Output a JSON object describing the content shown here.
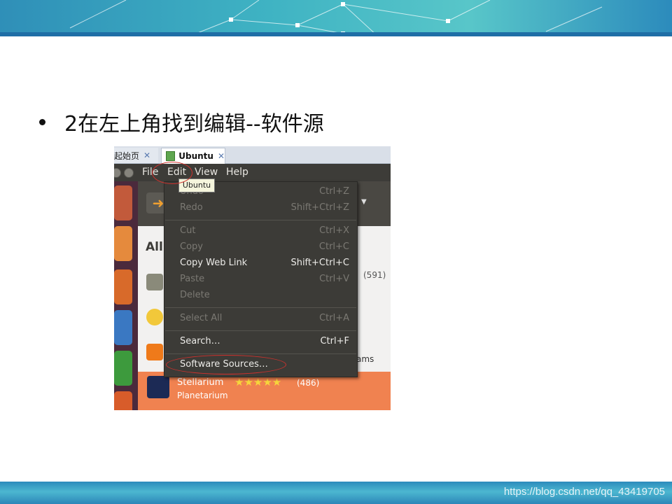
{
  "slide": {
    "instruction": "2在左上角找到编辑--软件源",
    "watermark": "https://blog.csdn.net/qq_43419705"
  },
  "browser_tabs": [
    {
      "label": "起始页",
      "close": "✕"
    },
    {
      "label": "Ubuntu",
      "close": "✕"
    }
  ],
  "menubar": {
    "file": "File",
    "edit": "Edit",
    "view": "View",
    "help": "Help"
  },
  "tooltip": "Ubuntu",
  "edit_menu": [
    {
      "label": "Undo",
      "shortcut": "Ctrl+Z",
      "enabled": false
    },
    {
      "label": "Redo",
      "shortcut": "Shift+Ctrl+Z",
      "enabled": false
    },
    {
      "label": "Cut",
      "shortcut": "Ctrl+X",
      "enabled": false
    },
    {
      "label": "Copy",
      "shortcut": "Ctrl+C",
      "enabled": false
    },
    {
      "label": "Copy Web Link",
      "shortcut": "Shift+Ctrl+C",
      "enabled": true
    },
    {
      "label": "Paste",
      "shortcut": "Ctrl+V",
      "enabled": false
    },
    {
      "label": "Delete",
      "shortcut": "",
      "enabled": false
    },
    {
      "label": "Select All",
      "shortcut": "Ctrl+A",
      "enabled": false
    },
    {
      "label": "Search…",
      "shortcut": "Ctrl+F",
      "enabled": true
    },
    {
      "label": "Software Sources…",
      "shortcut": "",
      "enabled": true
    }
  ],
  "software_center": {
    "section_label": "All",
    "partial_count": "(591)",
    "partial_text": "ams",
    "highlighted_app": {
      "name": "Stellarium",
      "stars": "★★★★★",
      "rating_count": "(486)",
      "description": "Planetarium"
    }
  },
  "colors": {
    "menu_bg": "#3c3b37",
    "highlight_row": "#f08250",
    "annotation_red": "#d0312d"
  }
}
